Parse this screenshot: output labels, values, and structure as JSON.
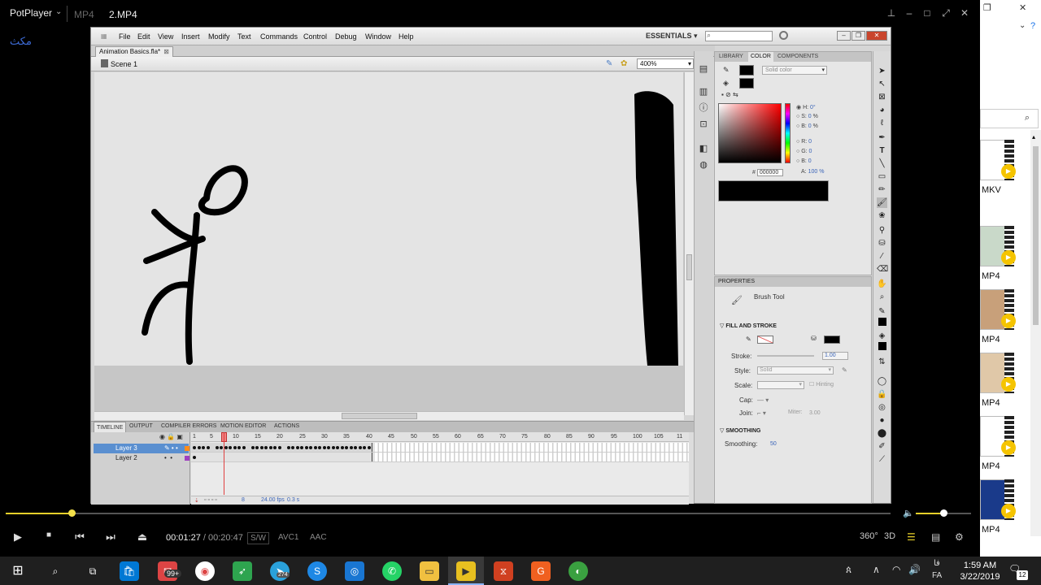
{
  "player": {
    "brand": "PotPlayer",
    "format_tab": "MP4",
    "file_name": "2.MP4",
    "side_text": "مكث",
    "current_time": "00:01:27",
    "separator": " / ",
    "total_time": "00:20:47",
    "render_tag": "S/W",
    "video_codec": "AVC1",
    "audio_codec": "AAC",
    "seek_progress": 0.074,
    "volume_level": 0.5,
    "vr_label": "360°",
    "threed_label": "3D"
  },
  "flash": {
    "menu": [
      "File",
      "Edit",
      "View",
      "Insert",
      "Modify",
      "Text",
      "Commands",
      "Control",
      "Debug",
      "Window",
      "Help"
    ],
    "workspace": "ESSENTIALS",
    "doc_tab": "Animation Basics.fla*",
    "scene": "Scene 1",
    "zoom": "400%",
    "timeline_tabs": [
      "TIMELINE",
      "OUTPUT",
      "COMPILER ERRORS",
      "MOTION EDITOR",
      "ACTIONS"
    ],
    "layers": [
      {
        "name": "Layer 3",
        "color": "#ff8c1a",
        "selected": true
      },
      {
        "name": "Layer 2",
        "color": "#a040c0",
        "selected": false
      }
    ],
    "ruler_ticks": [
      "1",
      "5",
      "10",
      "15",
      "20",
      "25",
      "30",
      "35",
      "40",
      "45",
      "50",
      "55",
      "60",
      "65",
      "70",
      "75",
      "80",
      "85",
      "90",
      "95",
      "100",
      "105",
      "11"
    ],
    "fps": "24.00 fps",
    "elapsed": "0.3 s",
    "current_frame": "8",
    "color_panel": {
      "tabs": [
        "LIBRARY",
        "COLOR",
        "COMPONENTS"
      ],
      "type": "Solid color",
      "h_label": "H:",
      "h_value": "0",
      "h_unit": "°",
      "s_label": "S:",
      "s_value": "0",
      "s_unit": "%",
      "b_label": "B:",
      "b_value": "0",
      "b_unit": "%",
      "r_label": "R:",
      "r_value": "0",
      "g_label": "G:",
      "g_value": "0",
      "bl_label": "B:",
      "bl_value": "0",
      "hex_label": "#",
      "hex": "000000",
      "alpha_label": "A:",
      "alpha": "100",
      "alpha_unit": "%"
    },
    "properties": {
      "title": "PROPERTIES",
      "tool": "Brush Tool",
      "fill_stroke": "FILL AND STROKE",
      "stroke_label": "Stroke:",
      "stroke_value": "1.00",
      "style_label": "Style:",
      "style_value": "Solid",
      "scale_label": "Scale:",
      "hinting": "Hinting",
      "cap_label": "Cap:",
      "join_label": "Join:",
      "miter_label": "Miter:",
      "miter_value": "3.00",
      "smoothing_section": "SMOOTHING",
      "smoothing_label": "Smoothing:",
      "smoothing_value": "50"
    }
  },
  "explorer": {
    "items": [
      {
        "caption": "MKV",
        "bg": "#ffffff"
      },
      {
        "caption": "MP4",
        "bg": "#c9d9c9"
      },
      {
        "caption": "MP4",
        "bg": "#c8a07a"
      },
      {
        "caption": "MP4",
        "bg": "#e0c8a8"
      },
      {
        "caption": "MP4",
        "bg": "#ffffff"
      },
      {
        "caption": "MP4",
        "bg": "#1a3a8a"
      }
    ]
  },
  "taskbar": {
    "time": "1:59 AM",
    "date": "3/22/2019",
    "lang": "FA",
    "lang_small": "فا",
    "mail_badge": "99+",
    "telegram_badge": "274",
    "notif_count": "12"
  }
}
